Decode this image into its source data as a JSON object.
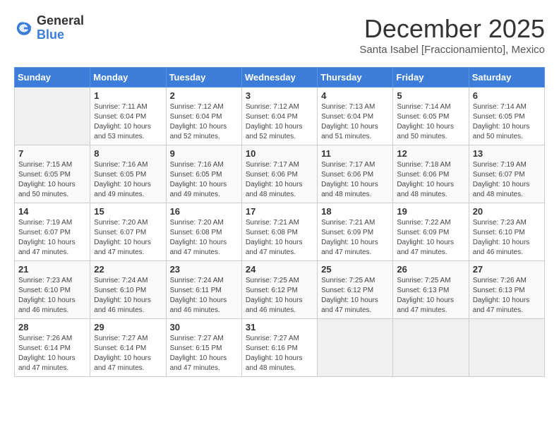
{
  "header": {
    "logo_general": "General",
    "logo_blue": "Blue",
    "month_title": "December 2025",
    "subtitle": "Santa Isabel [Fraccionamiento], Mexico"
  },
  "weekdays": [
    "Sunday",
    "Monday",
    "Tuesday",
    "Wednesday",
    "Thursday",
    "Friday",
    "Saturday"
  ],
  "weeks": [
    [
      {
        "day": "",
        "info": ""
      },
      {
        "day": "1",
        "info": "Sunrise: 7:11 AM\nSunset: 6:04 PM\nDaylight: 10 hours\nand 53 minutes."
      },
      {
        "day": "2",
        "info": "Sunrise: 7:12 AM\nSunset: 6:04 PM\nDaylight: 10 hours\nand 52 minutes."
      },
      {
        "day": "3",
        "info": "Sunrise: 7:12 AM\nSunset: 6:04 PM\nDaylight: 10 hours\nand 52 minutes."
      },
      {
        "day": "4",
        "info": "Sunrise: 7:13 AM\nSunset: 6:04 PM\nDaylight: 10 hours\nand 51 minutes."
      },
      {
        "day": "5",
        "info": "Sunrise: 7:14 AM\nSunset: 6:05 PM\nDaylight: 10 hours\nand 50 minutes."
      },
      {
        "day": "6",
        "info": "Sunrise: 7:14 AM\nSunset: 6:05 PM\nDaylight: 10 hours\nand 50 minutes."
      }
    ],
    [
      {
        "day": "7",
        "info": "Sunrise: 7:15 AM\nSunset: 6:05 PM\nDaylight: 10 hours\nand 50 minutes."
      },
      {
        "day": "8",
        "info": "Sunrise: 7:16 AM\nSunset: 6:05 PM\nDaylight: 10 hours\nand 49 minutes."
      },
      {
        "day": "9",
        "info": "Sunrise: 7:16 AM\nSunset: 6:05 PM\nDaylight: 10 hours\nand 49 minutes."
      },
      {
        "day": "10",
        "info": "Sunrise: 7:17 AM\nSunset: 6:06 PM\nDaylight: 10 hours\nand 48 minutes."
      },
      {
        "day": "11",
        "info": "Sunrise: 7:17 AM\nSunset: 6:06 PM\nDaylight: 10 hours\nand 48 minutes."
      },
      {
        "day": "12",
        "info": "Sunrise: 7:18 AM\nSunset: 6:06 PM\nDaylight: 10 hours\nand 48 minutes."
      },
      {
        "day": "13",
        "info": "Sunrise: 7:19 AM\nSunset: 6:07 PM\nDaylight: 10 hours\nand 48 minutes."
      }
    ],
    [
      {
        "day": "14",
        "info": "Sunrise: 7:19 AM\nSunset: 6:07 PM\nDaylight: 10 hours\nand 47 minutes."
      },
      {
        "day": "15",
        "info": "Sunrise: 7:20 AM\nSunset: 6:07 PM\nDaylight: 10 hours\nand 47 minutes."
      },
      {
        "day": "16",
        "info": "Sunrise: 7:20 AM\nSunset: 6:08 PM\nDaylight: 10 hours\nand 47 minutes."
      },
      {
        "day": "17",
        "info": "Sunrise: 7:21 AM\nSunset: 6:08 PM\nDaylight: 10 hours\nand 47 minutes."
      },
      {
        "day": "18",
        "info": "Sunrise: 7:21 AM\nSunset: 6:09 PM\nDaylight: 10 hours\nand 47 minutes."
      },
      {
        "day": "19",
        "info": "Sunrise: 7:22 AM\nSunset: 6:09 PM\nDaylight: 10 hours\nand 47 minutes."
      },
      {
        "day": "20",
        "info": "Sunrise: 7:23 AM\nSunset: 6:10 PM\nDaylight: 10 hours\nand 46 minutes."
      }
    ],
    [
      {
        "day": "21",
        "info": "Sunrise: 7:23 AM\nSunset: 6:10 PM\nDaylight: 10 hours\nand 46 minutes."
      },
      {
        "day": "22",
        "info": "Sunrise: 7:24 AM\nSunset: 6:10 PM\nDaylight: 10 hours\nand 46 minutes."
      },
      {
        "day": "23",
        "info": "Sunrise: 7:24 AM\nSunset: 6:11 PM\nDaylight: 10 hours\nand 46 minutes."
      },
      {
        "day": "24",
        "info": "Sunrise: 7:25 AM\nSunset: 6:12 PM\nDaylight: 10 hours\nand 46 minutes."
      },
      {
        "day": "25",
        "info": "Sunrise: 7:25 AM\nSunset: 6:12 PM\nDaylight: 10 hours\nand 47 minutes."
      },
      {
        "day": "26",
        "info": "Sunrise: 7:25 AM\nSunset: 6:13 PM\nDaylight: 10 hours\nand 47 minutes."
      },
      {
        "day": "27",
        "info": "Sunrise: 7:26 AM\nSunset: 6:13 PM\nDaylight: 10 hours\nand 47 minutes."
      }
    ],
    [
      {
        "day": "28",
        "info": "Sunrise: 7:26 AM\nSunset: 6:14 PM\nDaylight: 10 hours\nand 47 minutes."
      },
      {
        "day": "29",
        "info": "Sunrise: 7:27 AM\nSunset: 6:14 PM\nDaylight: 10 hours\nand 47 minutes."
      },
      {
        "day": "30",
        "info": "Sunrise: 7:27 AM\nSunset: 6:15 PM\nDaylight: 10 hours\nand 47 minutes."
      },
      {
        "day": "31",
        "info": "Sunrise: 7:27 AM\nSunset: 6:16 PM\nDaylight: 10 hours\nand 48 minutes."
      },
      {
        "day": "",
        "info": ""
      },
      {
        "day": "",
        "info": ""
      },
      {
        "day": "",
        "info": ""
      }
    ]
  ]
}
